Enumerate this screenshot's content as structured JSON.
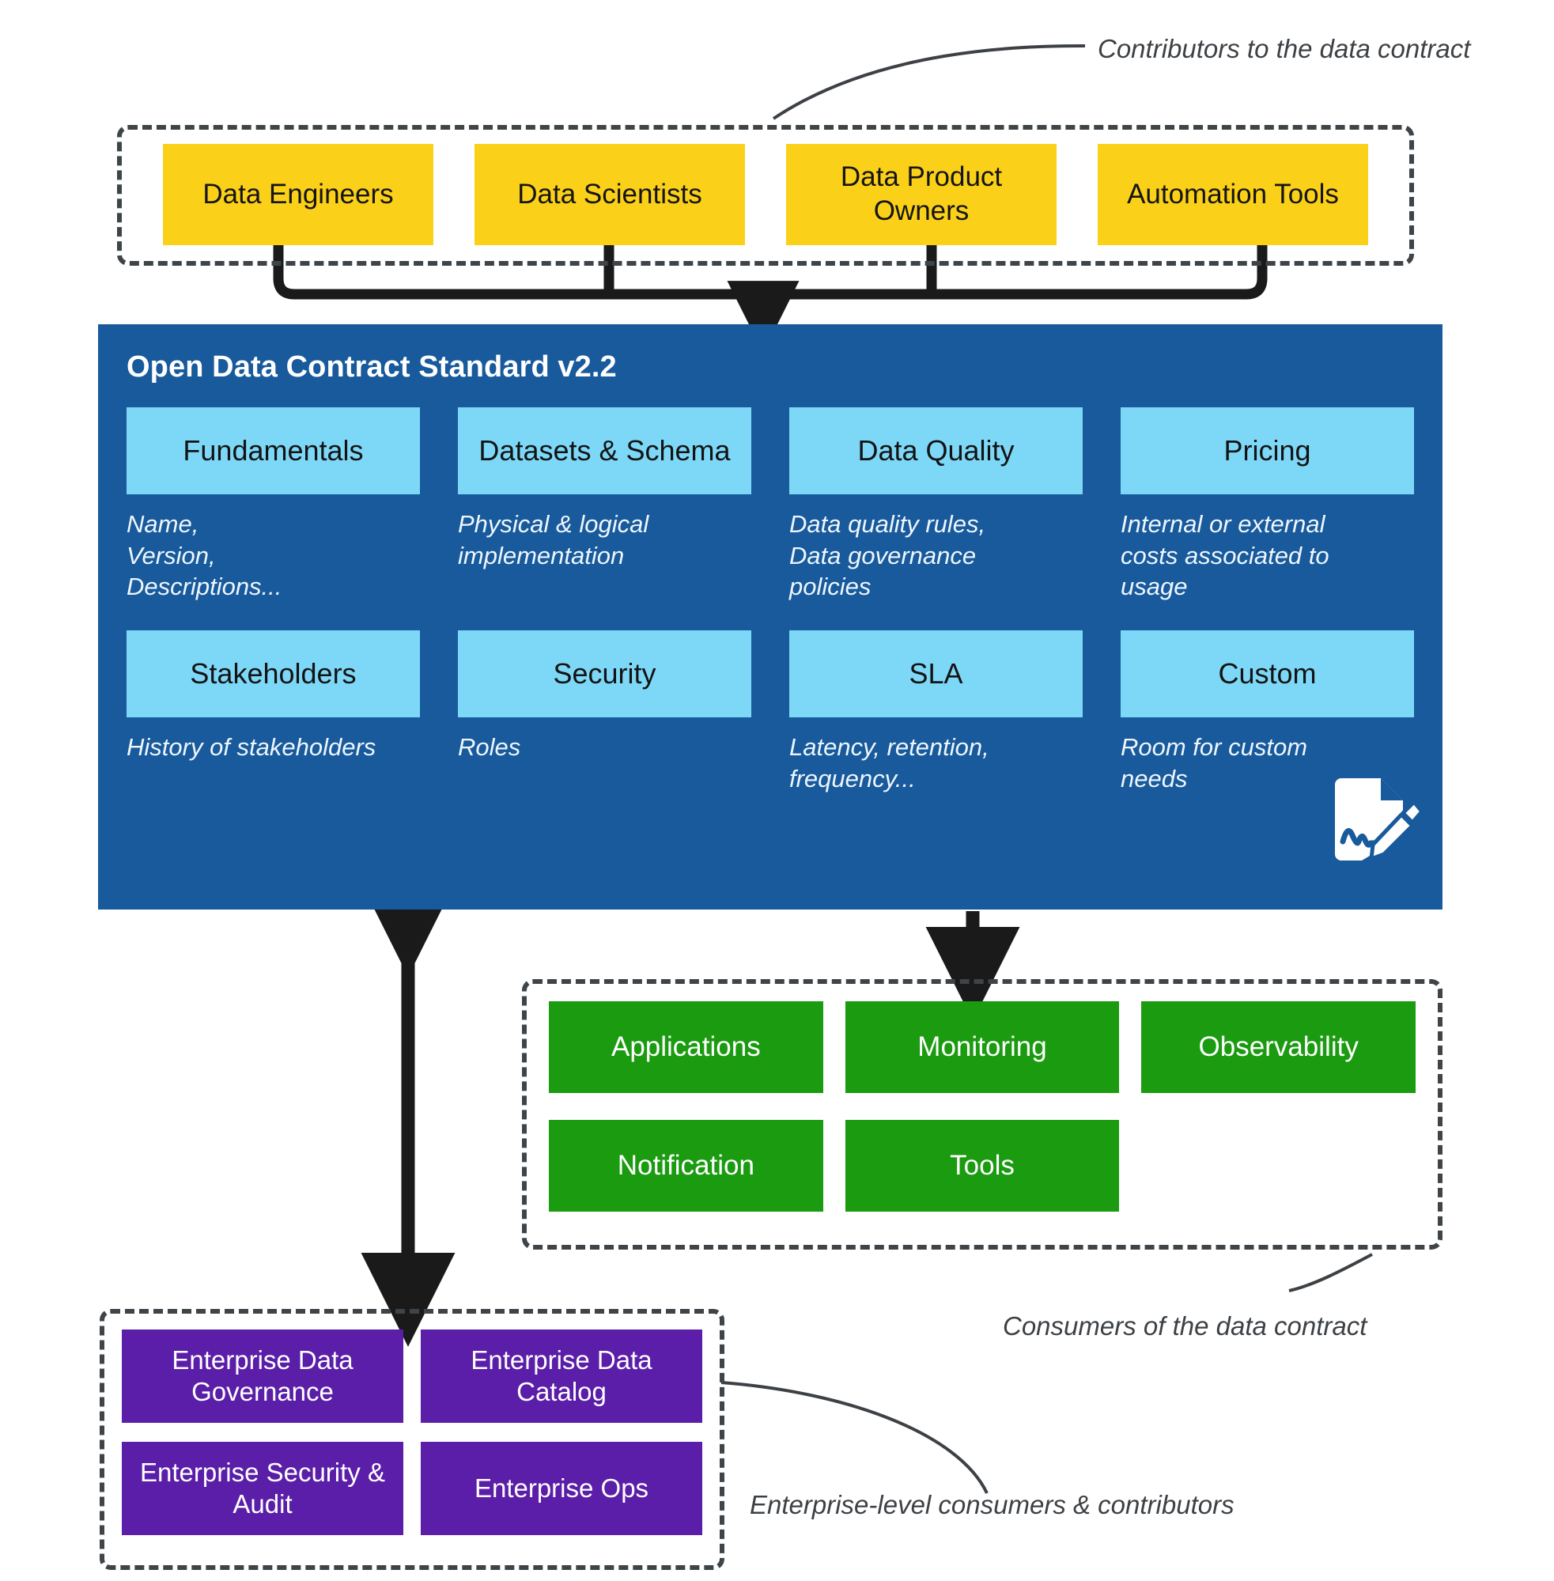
{
  "annotations": {
    "contributors": "Contributors to the data contract",
    "consumers": "Consumers of the data contract",
    "enterprise": "Enterprise-level consumers & contributors"
  },
  "colors": {
    "contributor_yellow": "#fbd019",
    "panel_blue": "#185a9c",
    "card_light_blue": "#7dd8f8",
    "consumer_green": "#1a9b10",
    "enterprise_purple": "#5b1ea8",
    "connector_black": "#1a1a1a",
    "dashed_gray": "#3f4448",
    "annotation_gray": "#3d4145"
  },
  "contributors": {
    "items": [
      {
        "label": "Data Engineers"
      },
      {
        "label": "Data Scientists"
      },
      {
        "label": "Data Product Owners"
      },
      {
        "label": "Automation Tools"
      }
    ]
  },
  "standard_panel": {
    "title": "Open Data Contract Standard v2.2",
    "icon": "document-signature-icon",
    "cards": [
      {
        "title": "Fundamentals",
        "desc": "Name,\nVersion,\nDescriptions..."
      },
      {
        "title": "Datasets & Schema",
        "desc": "Physical & logical\nimplementation"
      },
      {
        "title": "Data Quality",
        "desc": "Data quality rules,\nData governance\npolicies"
      },
      {
        "title": "Pricing",
        "desc": "Internal or external\ncosts associated to\nusage"
      },
      {
        "title": "Stakeholders",
        "desc": "History of stakeholders"
      },
      {
        "title": "Security",
        "desc": "Roles"
      },
      {
        "title": "SLA",
        "desc": "Latency, retention,\nfrequency..."
      },
      {
        "title": "Custom",
        "desc": "Room for custom\nneeds"
      }
    ]
  },
  "consumers": {
    "items": [
      {
        "label": "Applications"
      },
      {
        "label": "Monitoring"
      },
      {
        "label": "Observability"
      },
      {
        "label": "Notification"
      },
      {
        "label": "Tools"
      }
    ]
  },
  "enterprise": {
    "items": [
      {
        "label": "Enterprise Data Governance"
      },
      {
        "label": "Enterprise Data Catalog"
      },
      {
        "label": "Enterprise Security & Audit"
      },
      {
        "label": "Enterprise Ops"
      }
    ]
  }
}
